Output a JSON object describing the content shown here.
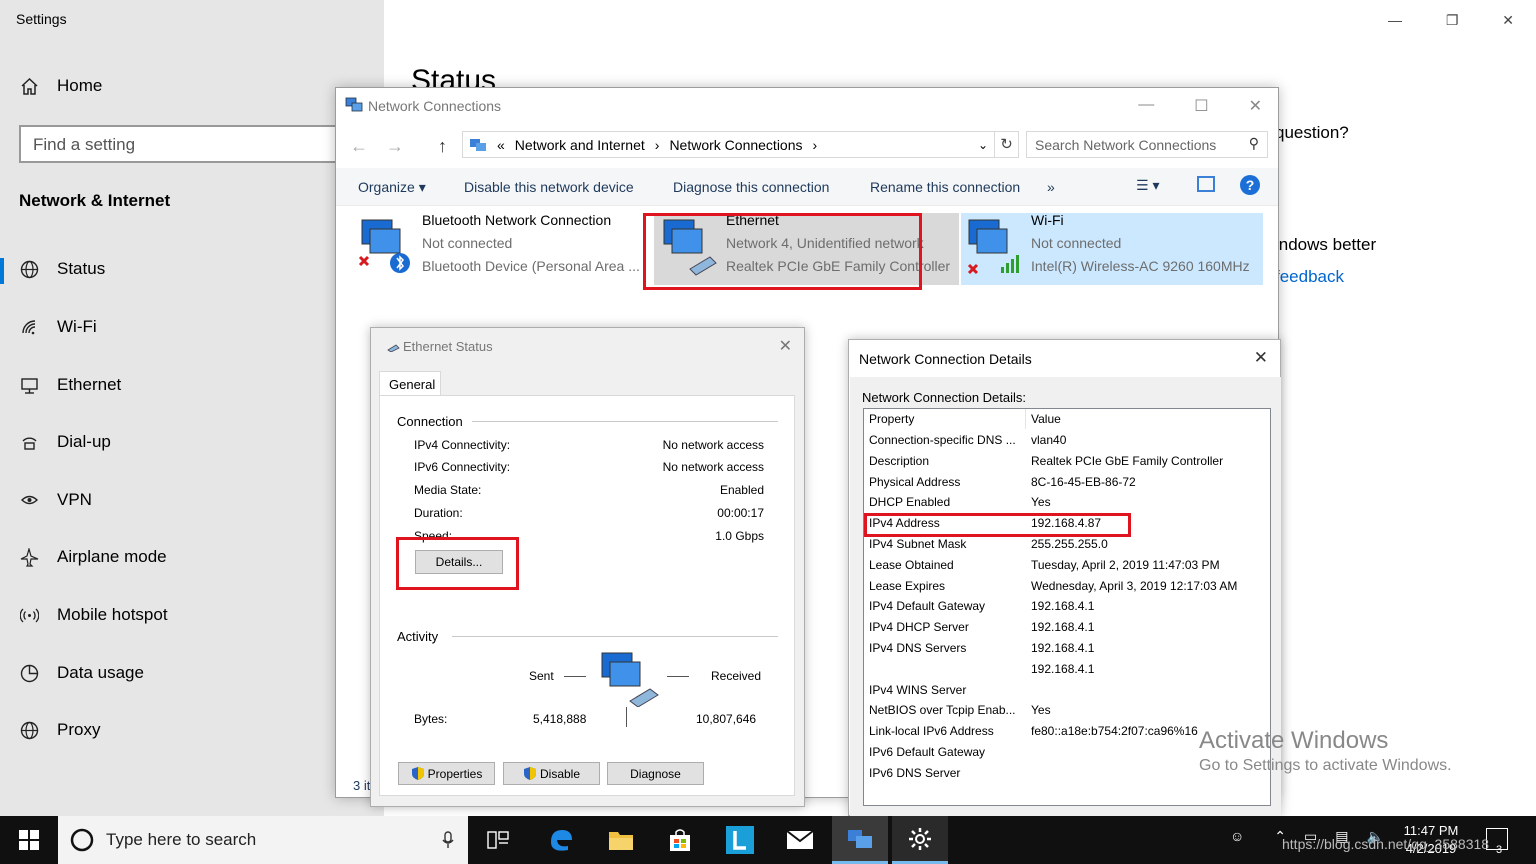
{
  "settings": {
    "window_title": "Settings",
    "home": "Home",
    "search_placeholder": "Find a setting",
    "section": "Network & Internet",
    "nav": [
      {
        "label": "Status",
        "icon": "globe-icon"
      },
      {
        "label": "Wi-Fi",
        "icon": "wifi-icon"
      },
      {
        "label": "Ethernet",
        "icon": "ethernet-icon"
      },
      {
        "label": "Dial-up",
        "icon": "dialup-icon"
      },
      {
        "label": "VPN",
        "icon": "vpn-icon"
      },
      {
        "label": "Airplane mode",
        "icon": "airplane-icon"
      },
      {
        "label": "Mobile hotspot",
        "icon": "hotspot-icon"
      },
      {
        "label": "Data usage",
        "icon": "data-usage-icon"
      },
      {
        "label": "Proxy",
        "icon": "proxy-icon"
      }
    ],
    "page_heading": "Status",
    "question_fragment": "question?",
    "windows_better_fragment": "indows better",
    "feedback_fragment": "feedback"
  },
  "activate": {
    "title": "Activate Windows",
    "subtitle": "Go to Settings to activate Windows."
  },
  "network_connections": {
    "title": "Network Connections",
    "breadcrumb": [
      "Network and Internet",
      "Network Connections"
    ],
    "breadcrumb_overflow": "«",
    "search_placeholder": "Search Network Connections",
    "toolbar": {
      "organize": "Organize",
      "disable": "Disable this network device",
      "diagnose": "Diagnose this connection",
      "rename": "Rename this connection",
      "more": "»"
    },
    "connections": [
      {
        "name": "Bluetooth Network Connection",
        "status": "Not connected",
        "device": "Bluetooth Device (Personal Area ..."
      },
      {
        "name": "Ethernet",
        "status": "Network 4, Unidentified network",
        "device": "Realtek PCIe GbE Family Controller"
      },
      {
        "name": "Wi-Fi",
        "status": "Not connected",
        "device": "Intel(R) Wireless-AC 9260 160MHz"
      }
    ],
    "item_count": "3 it"
  },
  "ethernet_status": {
    "title": "Ethernet Status",
    "tab": "General",
    "connection_label": "Connection",
    "rows": [
      {
        "k": "IPv4 Connectivity:",
        "v": "No network access"
      },
      {
        "k": "IPv6 Connectivity:",
        "v": "No network access"
      },
      {
        "k": "Media State:",
        "v": "Enabled"
      },
      {
        "k": "Duration:",
        "v": "00:00:17"
      },
      {
        "k": "Speed:",
        "v": "1.0 Gbps"
      }
    ],
    "details_button": "Details...",
    "activity_label": "Activity",
    "sent_label": "Sent",
    "received_label": "Received",
    "bytes_label": "Bytes:",
    "bytes_sent": "5,418,888",
    "bytes_received": "10,807,646",
    "properties_button": "Properties",
    "disable_button": "Disable",
    "diagnose_button": "Diagnose"
  },
  "details_window": {
    "title": "Network Connection Details",
    "label": "Network Connection Details:",
    "header": {
      "property": "Property",
      "value": "Value"
    },
    "rows": [
      {
        "p": "Connection-specific DNS ...",
        "v": "vlan40"
      },
      {
        "p": "Description",
        "v": "Realtek PCIe GbE Family Controller"
      },
      {
        "p": "Physical Address",
        "v": "8C-16-45-EB-86-72"
      },
      {
        "p": "DHCP Enabled",
        "v": "Yes"
      },
      {
        "p": "IPv4 Address",
        "v": "192.168.4.87"
      },
      {
        "p": "IPv4 Subnet Mask",
        "v": "255.255.255.0"
      },
      {
        "p": "Lease Obtained",
        "v": "Tuesday, April 2, 2019 11:47:03 PM"
      },
      {
        "p": "Lease Expires",
        "v": "Wednesday, April 3, 2019 12:17:03 AM"
      },
      {
        "p": "IPv4 Default Gateway",
        "v": "192.168.4.1"
      },
      {
        "p": "IPv4 DHCP Server",
        "v": "192.168.4.1"
      },
      {
        "p": "IPv4 DNS Servers",
        "v": "192.168.4.1"
      },
      {
        "p": "",
        "v": "192.168.4.1"
      },
      {
        "p": "IPv4 WINS Server",
        "v": ""
      },
      {
        "p": "NetBIOS over Tcpip Enab...",
        "v": "Yes"
      },
      {
        "p": "Link-local IPv6 Address",
        "v": "fe80::a18e:b754:2f07:ca96%16"
      },
      {
        "p": "IPv6 Default Gateway",
        "v": ""
      },
      {
        "p": "IPv6 DNS Server",
        "v": ""
      }
    ]
  },
  "taskbar": {
    "search_placeholder": "Type here to search",
    "time": "11:47 PM",
    "date": "4/2/2019",
    "notification_count": "3"
  },
  "watermark": "https://blog.csdn.net/qq_3588318",
  "colors": {
    "accent": "#0078d7",
    "highlight": "#e0141e"
  }
}
